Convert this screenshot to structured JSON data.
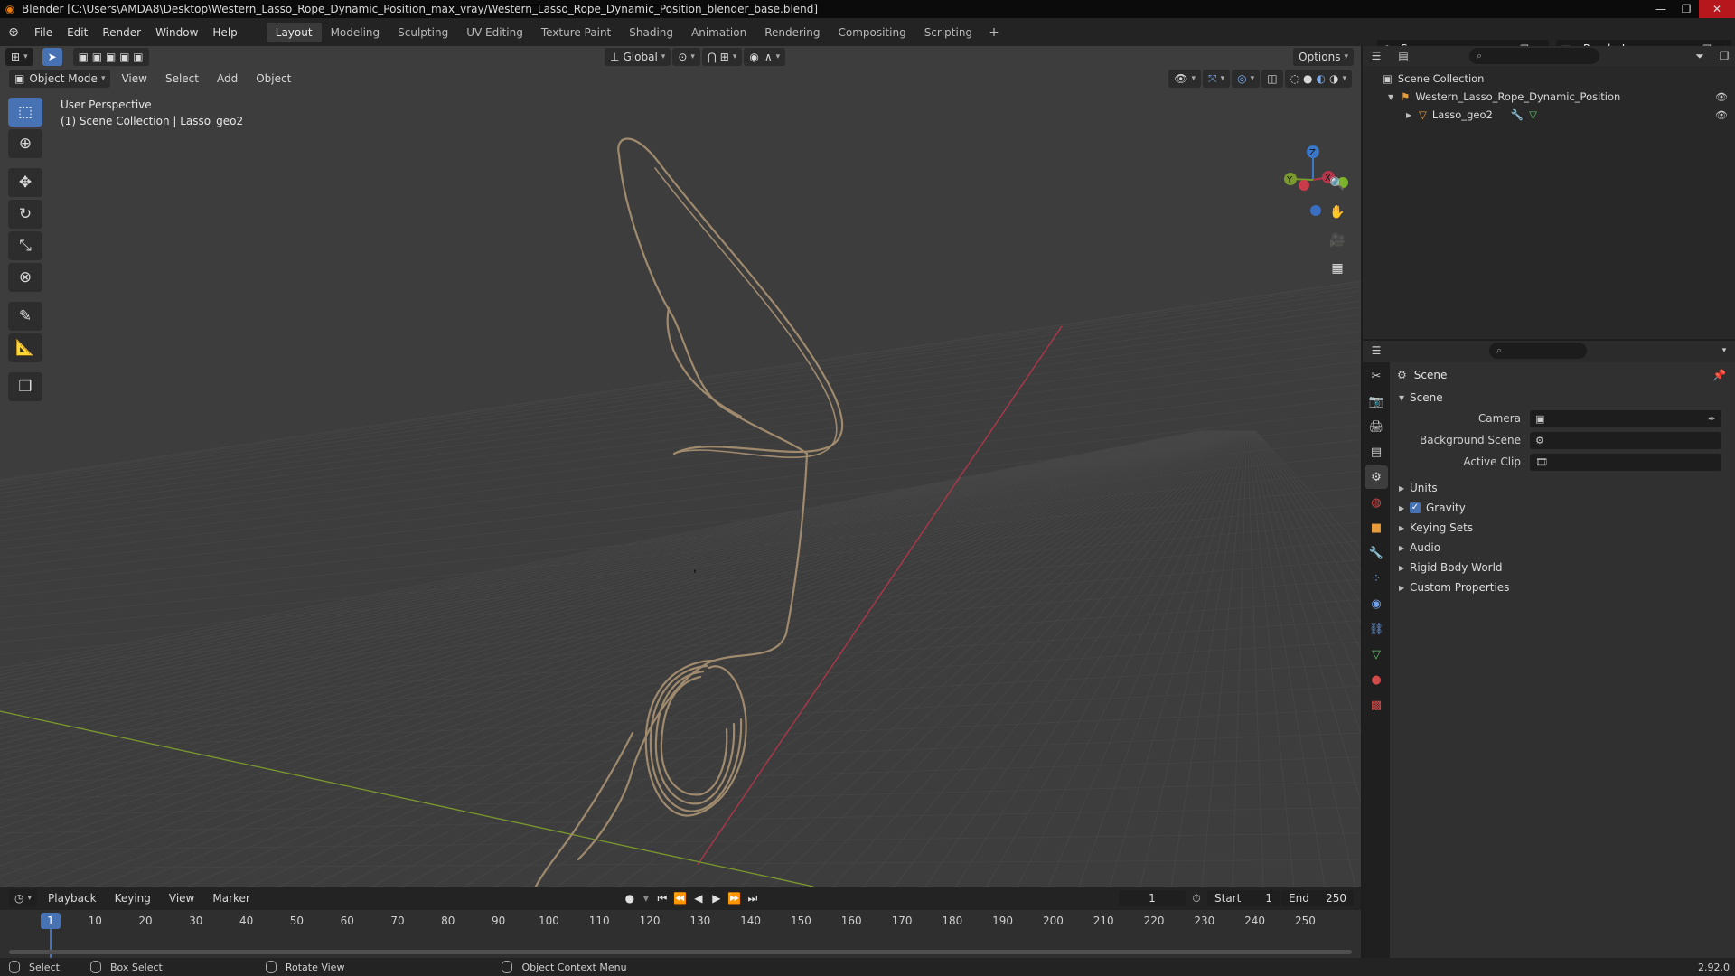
{
  "window": {
    "title": "Blender [C:\\Users\\AMDA8\\Desktop\\Western_Lasso_Rope_Dynamic_Position_max_vray/Western_Lasso_Rope_Dynamic_Position_blender_base.blend]"
  },
  "menu": [
    "File",
    "Edit",
    "Render",
    "Window",
    "Help"
  ],
  "workspaces": [
    "Layout",
    "Modeling",
    "Sculpting",
    "UV Editing",
    "Texture Paint",
    "Shading",
    "Animation",
    "Rendering",
    "Compositing",
    "Scripting"
  ],
  "active_workspace": "Layout",
  "scene_selector": "Scene",
  "view_layer_selector": "RenderLayer",
  "viewport": {
    "mode": "Object Mode",
    "menus": [
      "View",
      "Select",
      "Add",
      "Object"
    ],
    "transform_orientation": "Global",
    "options_label": "Options",
    "perspective_label": "User Perspective",
    "collection_label": "(1) Scene Collection | Lasso_geo2",
    "gizmo_axes": {
      "z": "Z",
      "y": "Y",
      "x": "X"
    },
    "colors": {
      "x_axis": "#b5364a",
      "y_axis": "#7a9a2d",
      "rope": "#a08a6d",
      "background": "#3d3d3d"
    }
  },
  "outliner": {
    "root": "Scene Collection",
    "items": [
      {
        "label": "Western_Lasso_Rope_Dynamic_Position",
        "icon": "collection-icon"
      },
      {
        "label": "Lasso_geo2",
        "icon": "object-icon"
      }
    ]
  },
  "properties": {
    "context_title": "Scene",
    "panel_title": "Scene",
    "fields": [
      {
        "label": "Camera",
        "value": ""
      },
      {
        "label": "Background Scene",
        "value": ""
      },
      {
        "label": "Active Clip",
        "value": ""
      }
    ],
    "subpanels": [
      "Units",
      "Gravity",
      "Keying Sets",
      "Audio",
      "Rigid Body World",
      "Custom Properties"
    ],
    "gravity_checked": true
  },
  "timeline": {
    "menus": [
      "Playback",
      "Keying",
      "View",
      "Marker"
    ],
    "current_frame": "1",
    "start_label": "Start",
    "start_value": "1",
    "end_label": "End",
    "end_value": "250",
    "ruler_labels": [
      "10",
      "20",
      "30",
      "40",
      "50",
      "60",
      "70",
      "80",
      "90",
      "100",
      "110",
      "120",
      "130",
      "140",
      "150",
      "160",
      "170",
      "180",
      "190",
      "200",
      "210",
      "220",
      "230",
      "240",
      "250"
    ]
  },
  "statusbar": {
    "items": [
      "Select",
      "Box Select",
      "Rotate View",
      "Object Context Menu"
    ],
    "version": "2.92.0"
  }
}
